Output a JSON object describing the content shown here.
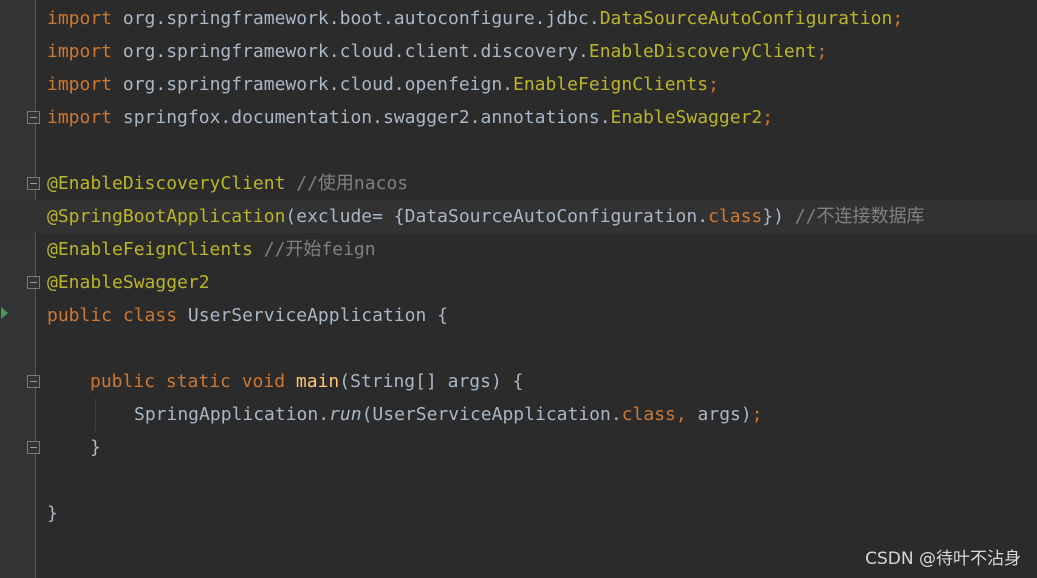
{
  "editor": {
    "lines": [
      {
        "segments": [
          [
            "kw",
            "import"
          ],
          [
            "pkg",
            " org.springframework.boot.autoconfigure.jdbc."
          ],
          [
            "cls",
            "DataSourceAutoConfiguration"
          ],
          [
            "semi",
            ";"
          ]
        ]
      },
      {
        "segments": [
          [
            "kw",
            "import"
          ],
          [
            "pkg",
            " org.springframework.cloud.client.discovery."
          ],
          [
            "cls",
            "EnableDiscoveryClient"
          ],
          [
            "semi",
            ";"
          ]
        ]
      },
      {
        "segments": [
          [
            "kw",
            "import"
          ],
          [
            "pkg",
            " org.springframework.cloud.openfeign."
          ],
          [
            "cls",
            "EnableFeignClients"
          ],
          [
            "semi",
            ";"
          ]
        ]
      },
      {
        "segments": [
          [
            "kw",
            "import"
          ],
          [
            "pkg",
            " springfox.documentation.swagger2.annotations."
          ],
          [
            "cls",
            "EnableSwagger2"
          ],
          [
            "semi",
            ";"
          ]
        ]
      },
      {
        "segments": []
      },
      {
        "segments": [
          [
            "ann",
            "@EnableDiscoveryClient"
          ],
          [
            "cmt",
            " //使用nacos"
          ]
        ]
      },
      {
        "segments": [
          [
            "ann",
            "@SpringBootApplication"
          ],
          [
            "plain",
            "(exclude= {DataSourceAutoConfiguration."
          ],
          [
            "kw",
            "class"
          ],
          [
            "plain",
            "}) "
          ],
          [
            "cmt",
            "//不连接数据库"
          ]
        ]
      },
      {
        "segments": [
          [
            "ann",
            "@EnableFeignClients"
          ],
          [
            "cmt",
            " //开始feign"
          ]
        ]
      },
      {
        "segments": [
          [
            "ann",
            "@EnableSwagger2"
          ]
        ]
      },
      {
        "segments": [
          [
            "kw",
            "public class "
          ],
          [
            "plain",
            "UserServiceApplication {"
          ]
        ]
      },
      {
        "segments": []
      },
      {
        "segments": [
          [
            "kw",
            "public static void "
          ],
          [
            "mth",
            "main"
          ],
          [
            "plain",
            "(String[] args) {"
          ]
        ]
      },
      {
        "segments": [
          [
            "plain",
            "SpringApplication."
          ],
          [
            "static-m",
            "run"
          ],
          [
            "plain",
            "(UserServiceApplication."
          ],
          [
            "kw",
            "class, "
          ],
          [
            "plain",
            "args)"
          ],
          [
            "semi",
            ";"
          ]
        ]
      },
      {
        "segments": [
          [
            "plain",
            "}"
          ]
        ]
      },
      {
        "segments": []
      },
      {
        "segments": [
          [
            "plain",
            "}"
          ]
        ]
      }
    ]
  },
  "watermark": "CSDN @待叶不沾身"
}
